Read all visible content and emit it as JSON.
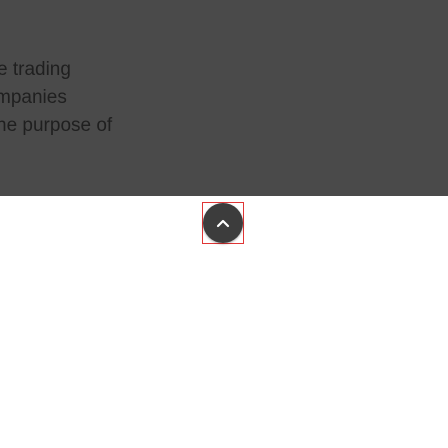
{
  "content": {
    "lines": [
      "e trading",
      "mpanies",
      "he purpose of"
    ]
  },
  "scroll_top_button": {
    "icon": "chevron-up-icon",
    "highlighted": true
  },
  "colors": {
    "panel_background": "#4a4a4a",
    "page_background": "#ffffff",
    "text": "#1f1f1f",
    "button": "#3c3c3c",
    "highlight": "#e03535"
  }
}
